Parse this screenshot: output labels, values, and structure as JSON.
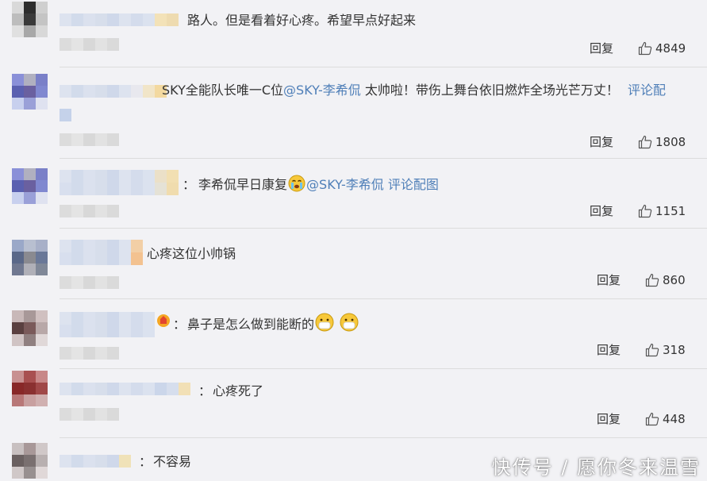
{
  "comments": [
    {
      "text": "路人。但是看着好心疼。希望早点好起来",
      "reply_label": "回复",
      "likes": "4849"
    },
    {
      "text_before": "SKY全能队长唯一C位",
      "mention": "@SKY-李希侃",
      "text_after": " 太帅啦！带伤上舞台依旧燃炸全场光芒万丈！",
      "link": "评论配",
      "reply_label": "回复",
      "likes": "1808"
    },
    {
      "colon": "：",
      "text": "李希侃早日康复",
      "mention": "@SKY-李希侃",
      "link": "评论配图",
      "reply_label": "回复",
      "likes": "1151"
    },
    {
      "text": "心疼这位小帅锅",
      "reply_label": "回复",
      "likes": "860"
    },
    {
      "colon": "：",
      "text": "鼻子是怎么做到能断的",
      "reply_label": "回复",
      "likes": "318"
    },
    {
      "colon": "：",
      "text": "心疼死了",
      "reply_label": "回复",
      "likes": "448"
    },
    {
      "colon": "：",
      "text": "不容易"
    }
  ],
  "watermark": "快传号 / 愿你冬来温雪",
  "colors": {
    "link": "#4f7fb8",
    "background": "#f2f2f5",
    "divider": "#dcdcdc"
  },
  "icons": {
    "like": "thumbs-up-icon",
    "emoji_cry": "crying-face-icon",
    "emoji_mask": "mask-face-icon"
  }
}
